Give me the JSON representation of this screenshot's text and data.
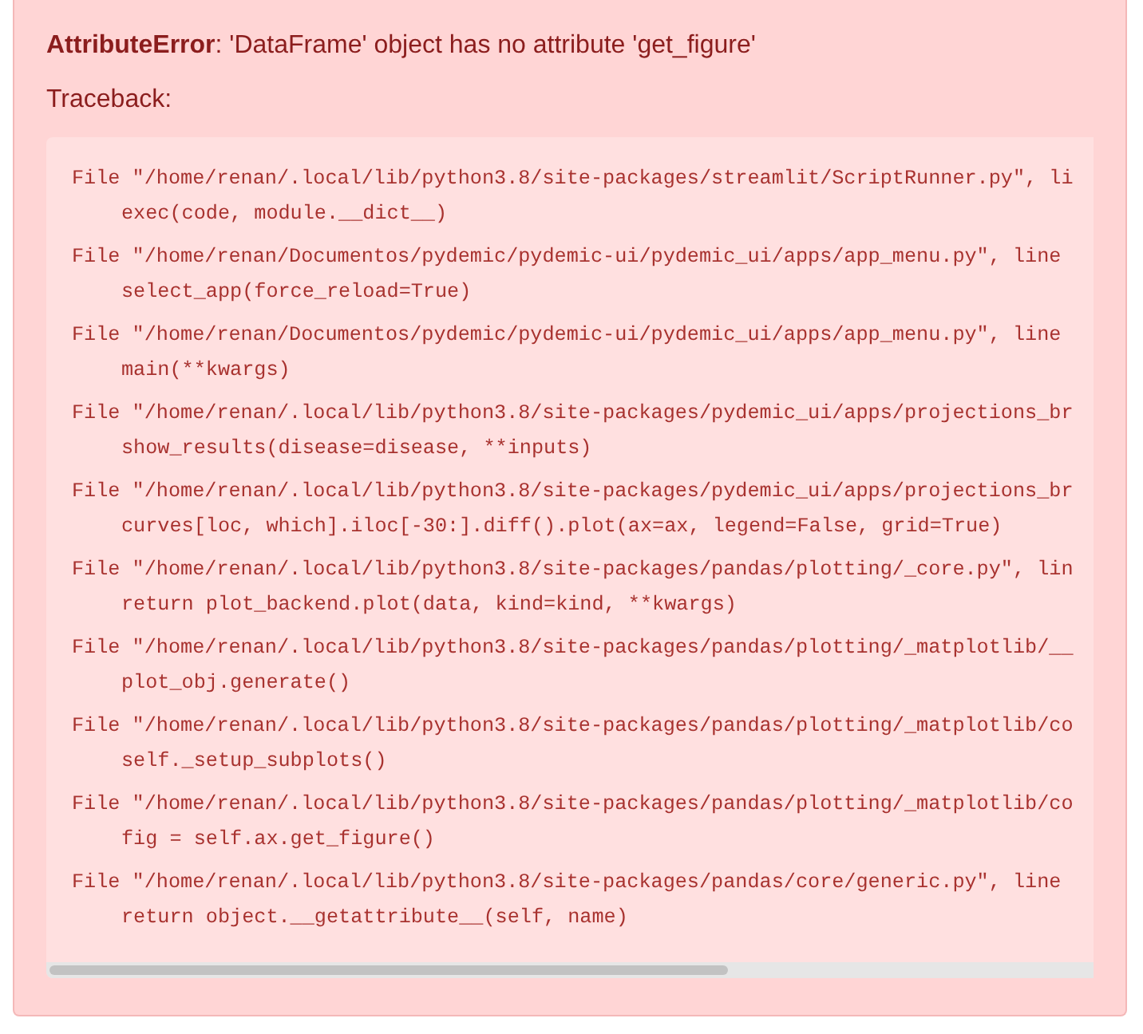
{
  "error": {
    "type": "AttributeError",
    "message": ": 'DataFrame' object has no attribute 'get_figure'"
  },
  "traceback_label": "Traceback:",
  "frames": [
    {
      "location": "File \"/home/renan/.local/lib/python3.8/site-packages/streamlit/ScriptRunner.py\", li",
      "code": "exec(code, module.__dict__)"
    },
    {
      "location": "File \"/home/renan/Documentos/pydemic/pydemic-ui/pydemic_ui/apps/app_menu.py\", line",
      "code": "select_app(force_reload=True)"
    },
    {
      "location": "File \"/home/renan/Documentos/pydemic/pydemic-ui/pydemic_ui/apps/app_menu.py\", line",
      "code": "main(**kwargs)"
    },
    {
      "location": "File \"/home/renan/.local/lib/python3.8/site-packages/pydemic_ui/apps/projections_br",
      "code": "show_results(disease=disease, **inputs)"
    },
    {
      "location": "File \"/home/renan/.local/lib/python3.8/site-packages/pydemic_ui/apps/projections_br",
      "code": "curves[loc, which].iloc[-30:].diff().plot(ax=ax, legend=False, grid=True)"
    },
    {
      "location": "File \"/home/renan/.local/lib/python3.8/site-packages/pandas/plotting/_core.py\", lin",
      "code": "return plot_backend.plot(data, kind=kind, **kwargs)"
    },
    {
      "location": "File \"/home/renan/.local/lib/python3.8/site-packages/pandas/plotting/_matplotlib/__",
      "code": "plot_obj.generate()"
    },
    {
      "location": "File \"/home/renan/.local/lib/python3.8/site-packages/pandas/plotting/_matplotlib/co",
      "code": "self._setup_subplots()"
    },
    {
      "location": "File \"/home/renan/.local/lib/python3.8/site-packages/pandas/plotting/_matplotlib/co",
      "code": "fig = self.ax.get_figure()"
    },
    {
      "location": "File \"/home/renan/.local/lib/python3.8/site-packages/pandas/core/generic.py\", line",
      "code": "return object.__getattribute__(self, name)"
    }
  ]
}
